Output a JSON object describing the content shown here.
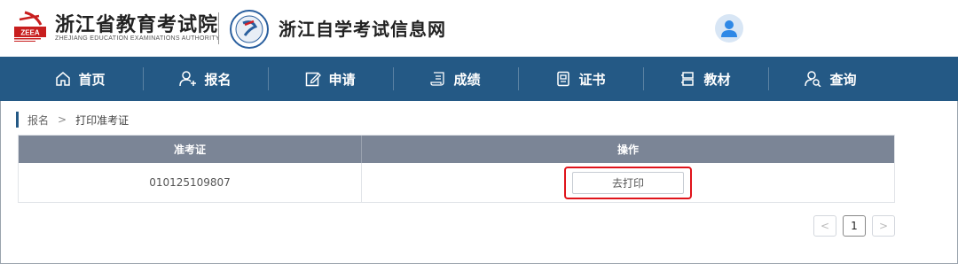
{
  "header": {
    "org_title": "浙江省教育考试院",
    "org_subtitle": "ZHEJIANG EDUCATION EXAMINATIONS AUTHORITY",
    "logo_text": "ZEEA",
    "site_title": "浙江自学考试信息网",
    "avatar_icon": "user-icon"
  },
  "nav": {
    "items": [
      {
        "label": "首页",
        "icon": "home-icon"
      },
      {
        "label": "报名",
        "icon": "user-add-icon"
      },
      {
        "label": "申请",
        "icon": "edit-icon"
      },
      {
        "label": "成绩",
        "icon": "scroll-icon"
      },
      {
        "label": "证书",
        "icon": "certificate-icon"
      },
      {
        "label": "教材",
        "icon": "book-icon"
      },
      {
        "label": "查询",
        "icon": "user-search-icon"
      }
    ]
  },
  "breadcrumb": {
    "parent": "报名",
    "separator": ">",
    "current": "打印准考证"
  },
  "table": {
    "headers": [
      "准考证",
      "操作"
    ],
    "rows": [
      {
        "ticket_number": "010125109807",
        "action_label": "去打印"
      }
    ]
  },
  "pagination": {
    "prev": "<",
    "current_page": "1",
    "next": ">"
  },
  "colors": {
    "nav_bg": "#245985",
    "table_header_bg": "#7b8596",
    "highlight": "#e0141b"
  }
}
